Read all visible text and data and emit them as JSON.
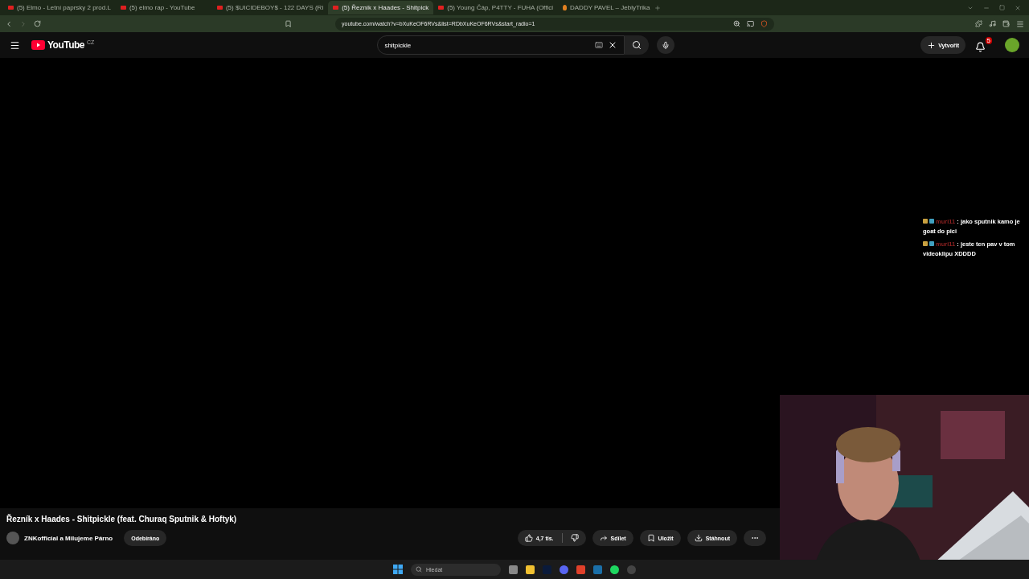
{
  "browser": {
    "tabs": [
      {
        "title": "(5) Elmo - Letní paprsky 2 prod.L",
        "selected": false
      },
      {
        "title": "(5) elmo rap - YouTube",
        "selected": false
      },
      {
        "title": "(5) $UICIDEBOY$ - 122 DAYS (Ri",
        "selected": false
      },
      {
        "title": "(5) Řezník x Haades - Shitpick",
        "selected": true
      },
      {
        "title": "(5) Young Čáp, P4TTY - FUHA (Offici",
        "selected": false
      },
      {
        "title": "DADDY PAVEL – JeblyTrika",
        "selected": false
      }
    ],
    "url": "youtube.com/watch?v=bXuKeOF6RVs&list=RDbXuKeOF6RVs&start_radio=1"
  },
  "youtube": {
    "logo": "YouTube",
    "region": "CZ",
    "search": "shitpickle",
    "create": "Vytvořit",
    "notifications": "5"
  },
  "video": {
    "title": "Řezník x Haades - Shitpickle (feat. Churaq Sputnik & Hoftyk)",
    "channel": "ZNKofficial a Milujeme Párno",
    "subscribe": "Odebíráno",
    "likes": "4,7 tis.",
    "share": "Sdílet",
    "save": "Uložit",
    "download": "Stáhnout"
  },
  "chat": [
    {
      "user": "muri11",
      "separator": ":",
      "text": "jako sputnik kamo je goat do pici"
    },
    {
      "user": "muri11",
      "separator": ":",
      "text": "jeste ten pav v tom videoklipu XDDDD"
    }
  ],
  "taskbar": {
    "search": "Hledat"
  }
}
